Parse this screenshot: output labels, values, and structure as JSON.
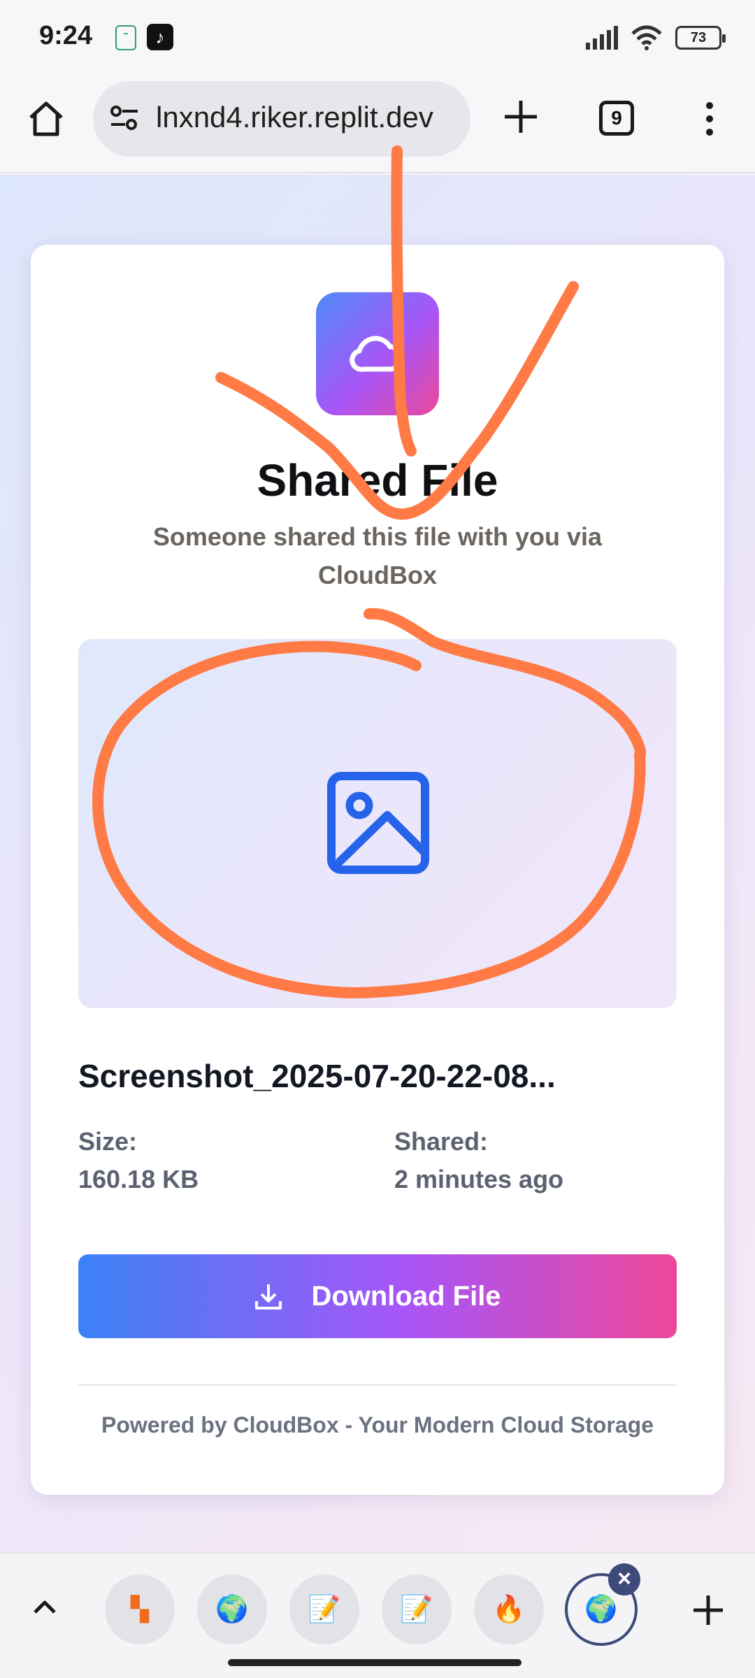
{
  "status_bar": {
    "time": "9:24",
    "battery": "73",
    "icons": [
      "notification-app-icon",
      "tiktok-icon",
      "signal-icon",
      "wifi-icon",
      "battery-icon"
    ]
  },
  "browser": {
    "url": "lnxnd4.riker.replit.dev",
    "tab_count": "9",
    "icons": [
      "home-icon",
      "site-settings-icon",
      "new-tab-plus-icon",
      "tabs-count-icon",
      "more-menu-icon"
    ]
  },
  "card": {
    "title": "Shared File",
    "subtitle": "Someone shared this file with you via CloudBox",
    "file_name": "Screenshot_2025-07-20-22-08...",
    "size_label": "Size:",
    "size_value": "160.18 KB",
    "shared_label": "Shared:",
    "shared_value": "2 minutes ago",
    "download_label": "Download File",
    "footer": "Powered by CloudBox - Your Modern Cloud Storage"
  },
  "tab_strip": {
    "tabs": [
      "app-tab-icon",
      "globe-icon",
      "notepad-icon",
      "notepad-icon",
      "flame-icon",
      "globe-icon"
    ],
    "active_index": 5
  },
  "colors": {
    "accent_blue": "#3b82f6",
    "accent_purple": "#a855f7",
    "accent_pink": "#ec4899",
    "image_icon_blue": "#2563eb",
    "annotation_orange": "#ff7a45"
  }
}
